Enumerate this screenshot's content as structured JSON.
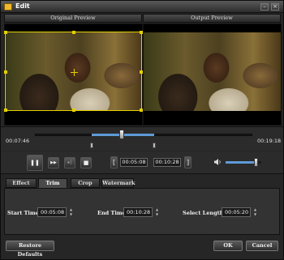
{
  "window": {
    "title": "Edit",
    "icon": "app-icon"
  },
  "titlebar_buttons": {
    "minimize": "–",
    "close": "×"
  },
  "preview": {
    "original_label": "Original Preview",
    "output_label": "Output Preview"
  },
  "timeline": {
    "current_time": "00:07:46",
    "total_time": "00:19:18",
    "position_fraction": 0.4,
    "selection_start_fraction": 0.26,
    "selection_end_fraction": 0.55
  },
  "playback": {
    "pause_icon": "❚❚",
    "fast_forward_icon": "▶▶",
    "frame_step_icon": "▸|",
    "stop_icon": "■",
    "set_start_icon": "[",
    "set_end_icon": "]",
    "start_time": "00:05:08",
    "end_time": "00:10:28",
    "volume_icon": "speaker-icon",
    "volume_fraction": 0.85
  },
  "tabs": [
    {
      "label": "Effect",
      "active": false
    },
    {
      "label": "Trim",
      "active": true
    },
    {
      "label": "Crop",
      "active": false
    },
    {
      "label": "Watermark",
      "active": false
    }
  ],
  "trim": {
    "start_label": "Start Time:",
    "start_value": "00:05:08",
    "end_label": "End Time:",
    "end_value": "00:10:28",
    "length_label": "Select Length:",
    "length_value": "00:05:20"
  },
  "buttons": {
    "restore": "Restore Defaults",
    "ok": "OK",
    "cancel": "Cancel"
  },
  "colors": {
    "accent": "#5f9bd6",
    "crop_frame": "#e4d000"
  }
}
